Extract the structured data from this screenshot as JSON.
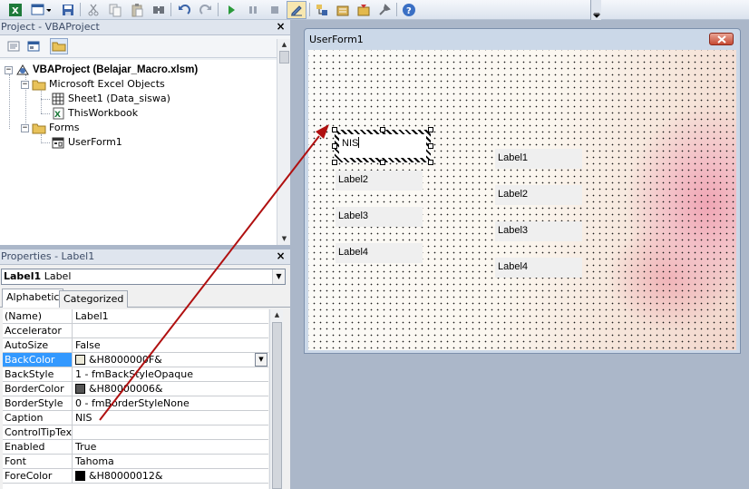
{
  "toolbar": {
    "icons": [
      "excel-icon",
      "insert-userform-icon",
      "save-icon",
      "cut-icon",
      "copy-icon",
      "paste-icon",
      "find-icon",
      "undo-icon",
      "redo-icon",
      "run-icon",
      "break-icon",
      "reset-icon",
      "design-mode-icon",
      "project-explorer-icon",
      "properties-icon",
      "object-browser-icon",
      "toolbox-icon",
      "help-icon"
    ]
  },
  "project": {
    "title": "Project - VBAProject",
    "close": "×",
    "root": "VBAProject (Belajar_Macro.xlsm)",
    "folder_excel": "Microsoft Excel Objects",
    "sheet1": "Sheet1 (Data_siswa)",
    "thisworkbook": "ThisWorkbook",
    "folder_forms": "Forms",
    "userform": "UserForm1",
    "toggle_minus": "−"
  },
  "properties": {
    "title": "Properties - Label1",
    "close": "×",
    "object_name": "Label1",
    "object_type": " Label",
    "tabs": [
      "Alphabetic",
      "Categorized"
    ],
    "rows": [
      {
        "name": "(Name)",
        "value": "Label1"
      },
      {
        "name": "Accelerator",
        "value": ""
      },
      {
        "name": "AutoSize",
        "value": "False"
      },
      {
        "name": "BackColor",
        "value": "&H8000000F&"
      },
      {
        "name": "BackStyle",
        "value": "1 - fmBackStyleOpaque"
      },
      {
        "name": "BorderColor",
        "value": "&H80000006&"
      },
      {
        "name": "BorderStyle",
        "value": "0 - fmBorderStyleNone"
      },
      {
        "name": "Caption",
        "value": "NIS"
      },
      {
        "name": "ControlTipText",
        "value": ""
      },
      {
        "name": "Enabled",
        "value": "True"
      },
      {
        "name": "Font",
        "value": "Tahoma"
      },
      {
        "name": "ForeColor",
        "value": "&H80000012&"
      }
    ],
    "colors": {
      "backcolor_swatch": "#ece9d8",
      "bordercolor_swatch": "#555555",
      "forecolor_swatch": "#000000",
      "selected_row": "#3399ff"
    }
  },
  "form": {
    "title": "UserForm1",
    "selected_label_caption": "NIS",
    "left_labels": [
      "Label2",
      "Label3",
      "Label4"
    ],
    "right_labels": [
      "Label1",
      "Label2",
      "Label3",
      "Label4"
    ]
  },
  "annotation": {
    "arrow_color": "#b01010"
  }
}
